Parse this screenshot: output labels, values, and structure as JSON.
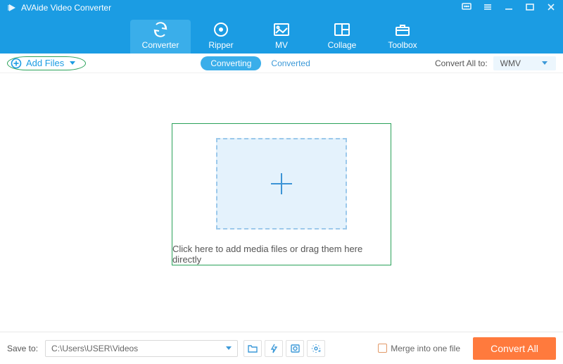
{
  "app": {
    "title": "AVAide Video Converter"
  },
  "nav": {
    "converter": "Converter",
    "ripper": "Ripper",
    "mv": "MV",
    "collage": "Collage",
    "toolbox": "Toolbox"
  },
  "subbar": {
    "add_files": "Add Files",
    "tab_converting": "Converting",
    "tab_converted": "Converted",
    "convert_all_to_label": "Convert All to:",
    "format": "WMV"
  },
  "drop": {
    "caption": "Click here to add media files or drag them here directly"
  },
  "footer": {
    "save_to_label": "Save to:",
    "path": "C:\\Users\\USER\\Videos",
    "merge_label": "Merge into one file",
    "convert_button": "Convert All"
  }
}
